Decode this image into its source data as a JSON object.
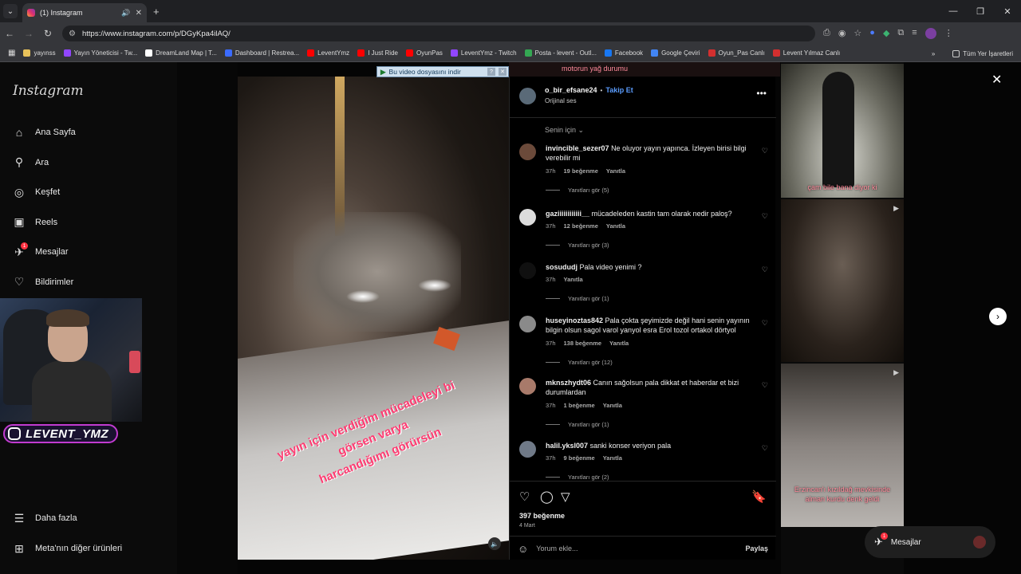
{
  "browser": {
    "tab_title": "(1) Instagram",
    "url": "https://www.instagram.com/p/DGyKpa4ilAQ/",
    "bookmarks": [
      {
        "label": "yayınss",
        "color": "#e8c25a"
      },
      {
        "label": "Yayın Yöneticisi - Tw...",
        "color": "#9146ff"
      },
      {
        "label": "DreamLand Map | T...",
        "color": "#ffffff"
      },
      {
        "label": "Dashboard | Restrea...",
        "color": "#3b6bff"
      },
      {
        "label": "LeventYmz",
        "color": "#ff0000"
      },
      {
        "label": "I Just Ride",
        "color": "#ff0000"
      },
      {
        "label": "OyunPas",
        "color": "#ff0000"
      },
      {
        "label": "LeventYmz - Twitch",
        "color": "#9146ff"
      },
      {
        "label": "Posta - levent - Outl...",
        "color": "#34a853"
      },
      {
        "label": "Facebook",
        "color": "#1877f2"
      },
      {
        "label": "Google Çeviri",
        "color": "#4285f4"
      },
      {
        "label": "Oyun_Pas Canlı",
        "color": "#d32f2f"
      },
      {
        "label": "Levent Yılmaz Canlı",
        "color": "#d32f2f"
      }
    ],
    "all_bookmarks": "Tüm Yer İşaretleri"
  },
  "sidebar": {
    "logo": "Instagram",
    "items": [
      {
        "label": "Ana Sayfa",
        "icon": "home-icon",
        "glyph": "⌂"
      },
      {
        "label": "Ara",
        "icon": "search-icon",
        "glyph": "⚲"
      },
      {
        "label": "Keşfet",
        "icon": "compass-icon",
        "glyph": "◎"
      },
      {
        "label": "Reels",
        "icon": "reels-icon",
        "glyph": "▣"
      },
      {
        "label": "Mesajlar",
        "icon": "messenger-icon",
        "glyph": "✈",
        "badge": "1"
      },
      {
        "label": "Bildirimler",
        "icon": "heart-icon",
        "glyph": "♡"
      }
    ],
    "more": "Daha fazla",
    "meta": "Meta'nın diğer ürünleri"
  },
  "overlay": {
    "streamer_name": "LEVENT_YMZ",
    "download_bar": "Bu video dosyasını indir"
  },
  "video": {
    "caption_lines": [
      "yayın için verdiğim mücadeleyi bi",
      "görsen varya",
      "harcandığımı görürsün"
    ]
  },
  "post": {
    "username": "o_bir_efsane24",
    "follow": "Takip Et",
    "audio": "Orijinal ses",
    "sort": "Senin için",
    "likes": "397 beğenme",
    "date": "4 Mart",
    "comment_placeholder": "Yorum ekle...",
    "share": "Paylaş"
  },
  "comments": [
    {
      "user": "invincible_sezer07",
      "text": "Ne oluyor yayın yapınca. İzleyen birisi bilgi verebilir mi",
      "time": "37h",
      "likes": "19 beğenme",
      "reply": "Yanıtla",
      "replies": "Yanıtları gör (5)",
      "avatar": "#6b4a3a"
    },
    {
      "user": "gaziiiiiiiiiiii__",
      "text": "mücadeleden kastin tam olarak nedir paloş?",
      "time": "37h",
      "likes": "12 beğenme",
      "reply": "Yanıtla",
      "replies": "Yanıtları gör (3)",
      "avatar": "#dcdcdc"
    },
    {
      "user": "sosududj",
      "text": "Pala video yenimi ?",
      "time": "37h",
      "likes": "",
      "reply": "Yanıtla",
      "replies": "Yanıtları gör (1)",
      "avatar": "#101010"
    },
    {
      "user": "huseyinoztas842",
      "text": "Pala çokta şeyimizde değil hani senin yayının bilgin olsun sagol varol yanyol esra Erol tozol ortakol dörtyol",
      "time": "37h",
      "likes": "138 beğenme",
      "reply": "Yanıtla",
      "replies": "Yanıtları gör (12)",
      "avatar": "#8a8a8a"
    },
    {
      "user": "mknszhydt06",
      "text": "Canın sağolsun pala dikkat et haberdar et bizi durumlardan",
      "time": "37h",
      "likes": "1 beğenme",
      "reply": "Yanıtla",
      "replies": "Yanıtları gör (1)",
      "avatar": "#a87a6a"
    },
    {
      "user": "halil.yksl007",
      "text": "sanki konser veriyon pala",
      "time": "37h",
      "likes": "9 beğenme",
      "reply": "Yanıtla",
      "replies": "Yanıtları gör (2)",
      "avatar": "#707a88"
    }
  ],
  "grid": {
    "top_text": "motorun yağ durumu",
    "tile1_text": "çam bile bana diyor ki",
    "tile3_text": "Erzincan'ı kızıldağ mevkisinde alman kurdu denk geldi"
  },
  "messages_pill": {
    "label": "Mesajlar",
    "badge": "1"
  }
}
